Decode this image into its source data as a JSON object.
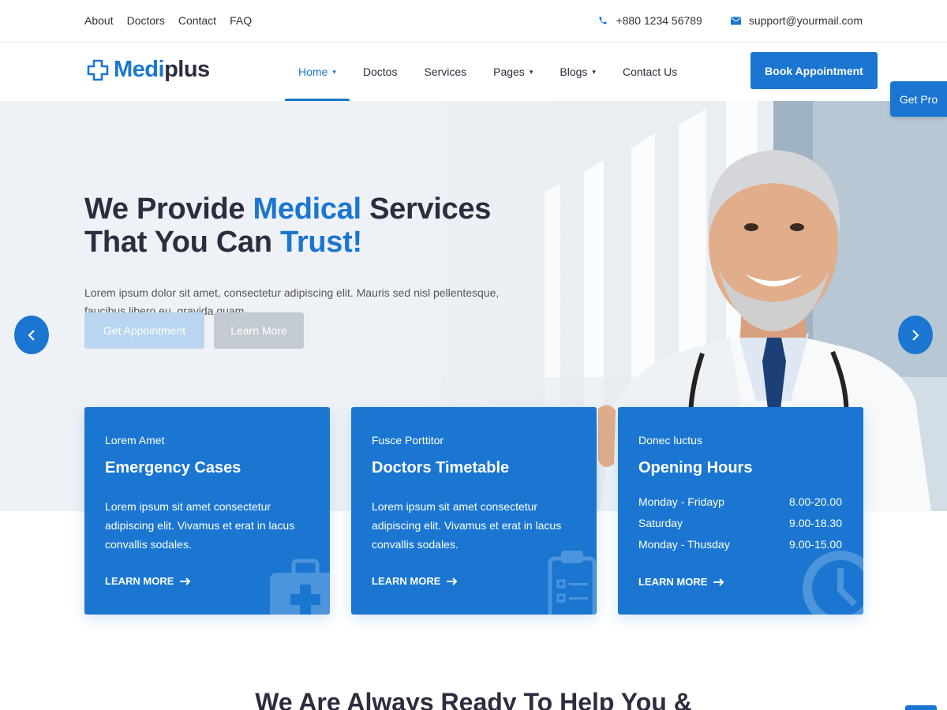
{
  "topbar": {
    "links": [
      "About",
      "Doctors",
      "Contact",
      "FAQ"
    ],
    "phone": "+880 1234 56789",
    "email": "support@yourmail.com"
  },
  "header": {
    "logo_part1": "Medi",
    "logo_part2": "plus",
    "nav": [
      "Home",
      "Doctos",
      "Services",
      "Pages",
      "Blogs",
      "Contact Us"
    ],
    "book_label": "Book Appointment",
    "get_pro": "Get Pro"
  },
  "hero": {
    "line1_a": "We Provide ",
    "line1_b": "Medical",
    "line1_c": " Services",
    "line2_a": "That You Can ",
    "line2_b": "Trust!",
    "desc": "Lorem ipsum dolor sit amet, consectetur adipiscing elit. Mauris sed nisl pellentesque, faucibus libero eu, gravida quam.",
    "btn_primary": "Get Appointment",
    "btn_secondary": "Learn More"
  },
  "cards": [
    {
      "kicker": "Lorem Amet",
      "title": "Emergency Cases",
      "desc": "Lorem ipsum sit amet consectetur adipiscing elit. Vivamus et erat in lacus convallis sodales.",
      "more": "LEARN MORE"
    },
    {
      "kicker": "Fusce Porttitor",
      "title": "Doctors Timetable",
      "desc": "Lorem ipsum sit amet consectetur adipiscing elit. Vivamus et erat in lacus convallis sodales.",
      "more": "LEARN MORE"
    },
    {
      "kicker": "Donec luctus",
      "title": "Opening Hours",
      "hours": [
        {
          "day": "Monday - Fridayp",
          "time": "8.00-20.00"
        },
        {
          "day": "Saturday",
          "time": "9.00-18.30"
        },
        {
          "day": "Monday - Thusday",
          "time": "9.00-15.00"
        }
      ],
      "more": "LEARN MORE"
    }
  ],
  "section_title": "We Are Always Ready To Help You &",
  "colors": {
    "accent": "#1a76d1",
    "text": "#2c2d3f"
  },
  "icons": [
    "phone-icon",
    "mail-icon",
    "logo-cross-icon",
    "chevron-left-icon",
    "chevron-right-icon",
    "arrow-right-icon",
    "medical-kit-icon",
    "clipboard-icon",
    "clock-icon"
  ]
}
